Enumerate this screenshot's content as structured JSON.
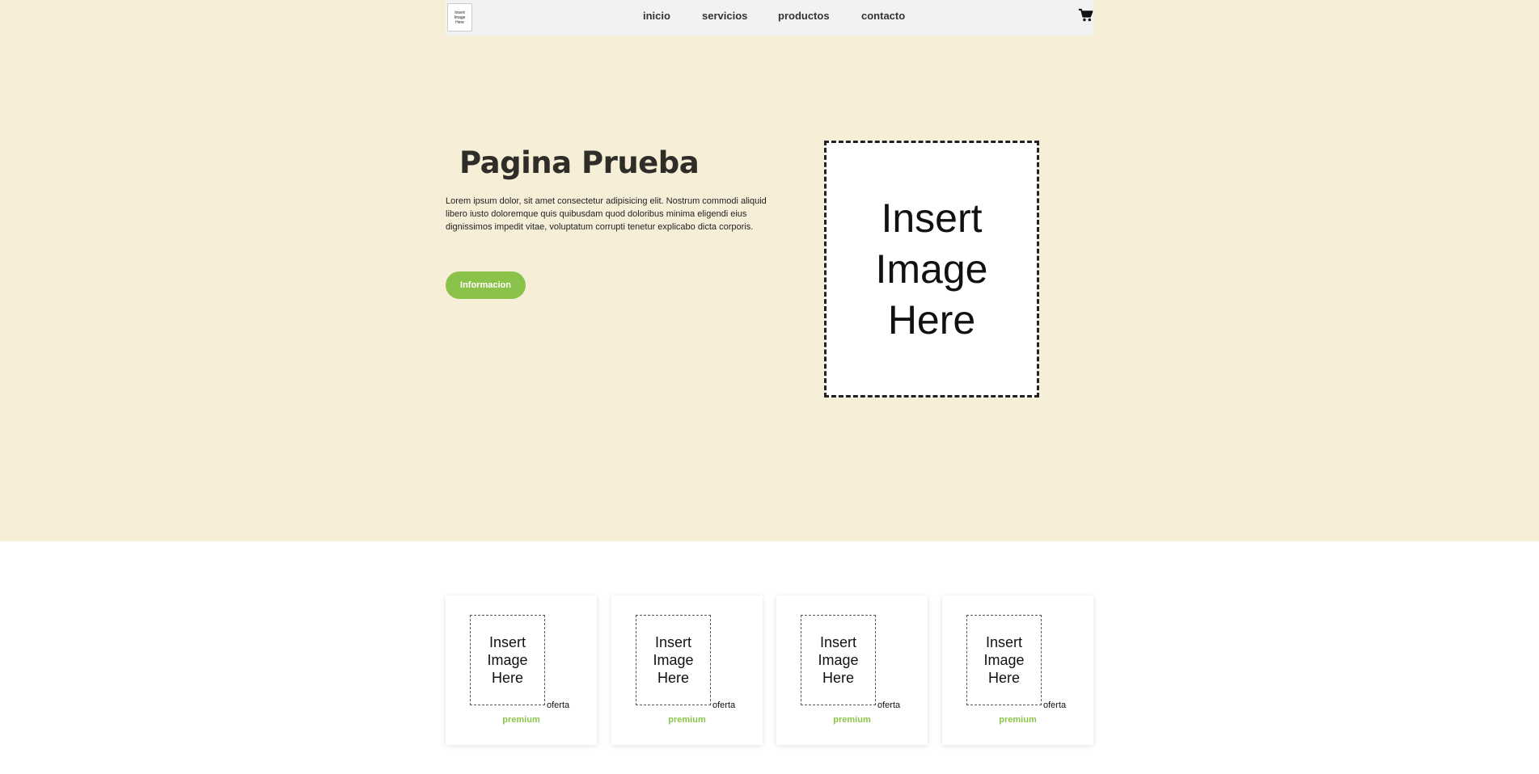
{
  "header": {
    "logo_text": "Insert Image Here",
    "nav": [
      {
        "label": "inicio"
      },
      {
        "label": "servicios"
      },
      {
        "label": "productos"
      },
      {
        "label": "contacto"
      }
    ],
    "cart_icon": "shopping-cart-icon"
  },
  "hero": {
    "title": "Pagina Prueba",
    "text": "Lorem ipsum dolor, sit amet consectetur adipisicing elit. Nostrum commodi aliquid libero iusto doloremque quis quibusdam quod doloribus minima eligendi eius dignissimos impedit vitae, voluptatum corrupti tenetur explicabo dicta corporis.",
    "button_label": "Informacion",
    "image_text": "Insert Image Here"
  },
  "products": [
    {
      "image_text": "Insert Image Here",
      "offer": "oferta",
      "badge": "premium"
    },
    {
      "image_text": "Insert Image Here",
      "offer": "oferta",
      "badge": "premium"
    },
    {
      "image_text": "Insert Image Here",
      "offer": "oferta",
      "badge": "premium"
    },
    {
      "image_text": "Insert Image Here",
      "offer": "oferta",
      "badge": "premium"
    }
  ],
  "colors": {
    "hero_background": "#f6eed7",
    "accent": "#8bc34a",
    "navbar": "#f2f2f2"
  }
}
